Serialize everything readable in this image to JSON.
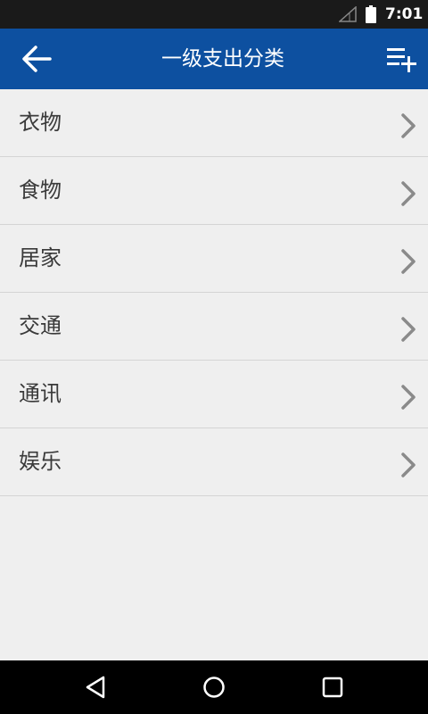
{
  "status_bar": {
    "time": "7:01",
    "signal_icon": "signal-icon",
    "battery_icon": "battery-icon"
  },
  "app_bar": {
    "title": "一级支出分类",
    "background_color": "#0d50a0",
    "back_icon": "arrow-left-icon",
    "action_icon": "playlist-add-icon"
  },
  "categories": [
    {
      "label": "衣物"
    },
    {
      "label": "食物"
    },
    {
      "label": "居家"
    },
    {
      "label": "交通"
    },
    {
      "label": "通讯"
    },
    {
      "label": "娱乐"
    }
  ],
  "item_icon": "chevron-right-icon",
  "nav_bar": {
    "back_icon": "nav-back-icon",
    "home_icon": "nav-home-icon",
    "recent_icon": "nav-recent-apps-icon"
  }
}
